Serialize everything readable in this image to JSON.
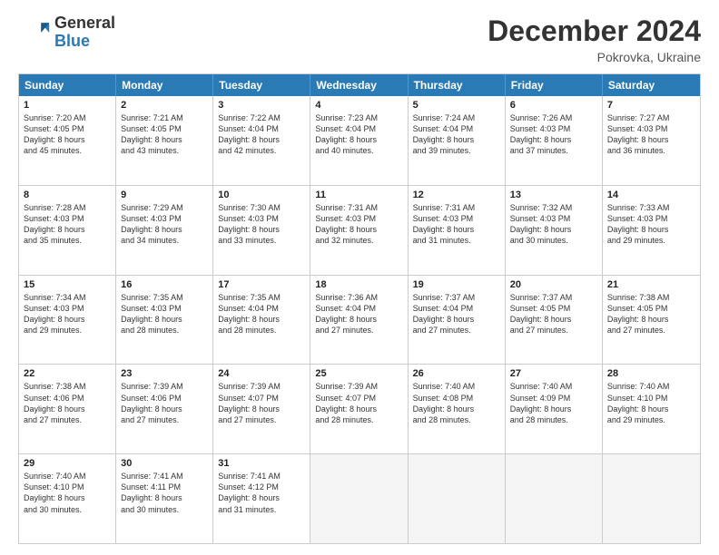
{
  "header": {
    "logo_general": "General",
    "logo_blue": "Blue",
    "month_year": "December 2024",
    "location": "Pokrovka, Ukraine"
  },
  "weekdays": [
    "Sunday",
    "Monday",
    "Tuesday",
    "Wednesday",
    "Thursday",
    "Friday",
    "Saturday"
  ],
  "weeks": [
    [
      {
        "day": "1",
        "lines": [
          "Sunrise: 7:20 AM",
          "Sunset: 4:05 PM",
          "Daylight: 8 hours",
          "and 45 minutes."
        ]
      },
      {
        "day": "2",
        "lines": [
          "Sunrise: 7:21 AM",
          "Sunset: 4:05 PM",
          "Daylight: 8 hours",
          "and 43 minutes."
        ]
      },
      {
        "day": "3",
        "lines": [
          "Sunrise: 7:22 AM",
          "Sunset: 4:04 PM",
          "Daylight: 8 hours",
          "and 42 minutes."
        ]
      },
      {
        "day": "4",
        "lines": [
          "Sunrise: 7:23 AM",
          "Sunset: 4:04 PM",
          "Daylight: 8 hours",
          "and 40 minutes."
        ]
      },
      {
        "day": "5",
        "lines": [
          "Sunrise: 7:24 AM",
          "Sunset: 4:04 PM",
          "Daylight: 8 hours",
          "and 39 minutes."
        ]
      },
      {
        "day": "6",
        "lines": [
          "Sunrise: 7:26 AM",
          "Sunset: 4:03 PM",
          "Daylight: 8 hours",
          "and 37 minutes."
        ]
      },
      {
        "day": "7",
        "lines": [
          "Sunrise: 7:27 AM",
          "Sunset: 4:03 PM",
          "Daylight: 8 hours",
          "and 36 minutes."
        ]
      }
    ],
    [
      {
        "day": "8",
        "lines": [
          "Sunrise: 7:28 AM",
          "Sunset: 4:03 PM",
          "Daylight: 8 hours",
          "and 35 minutes."
        ]
      },
      {
        "day": "9",
        "lines": [
          "Sunrise: 7:29 AM",
          "Sunset: 4:03 PM",
          "Daylight: 8 hours",
          "and 34 minutes."
        ]
      },
      {
        "day": "10",
        "lines": [
          "Sunrise: 7:30 AM",
          "Sunset: 4:03 PM",
          "Daylight: 8 hours",
          "and 33 minutes."
        ]
      },
      {
        "day": "11",
        "lines": [
          "Sunrise: 7:31 AM",
          "Sunset: 4:03 PM",
          "Daylight: 8 hours",
          "and 32 minutes."
        ]
      },
      {
        "day": "12",
        "lines": [
          "Sunrise: 7:31 AM",
          "Sunset: 4:03 PM",
          "Daylight: 8 hours",
          "and 31 minutes."
        ]
      },
      {
        "day": "13",
        "lines": [
          "Sunrise: 7:32 AM",
          "Sunset: 4:03 PM",
          "Daylight: 8 hours",
          "and 30 minutes."
        ]
      },
      {
        "day": "14",
        "lines": [
          "Sunrise: 7:33 AM",
          "Sunset: 4:03 PM",
          "Daylight: 8 hours",
          "and 29 minutes."
        ]
      }
    ],
    [
      {
        "day": "15",
        "lines": [
          "Sunrise: 7:34 AM",
          "Sunset: 4:03 PM",
          "Daylight: 8 hours",
          "and 29 minutes."
        ]
      },
      {
        "day": "16",
        "lines": [
          "Sunrise: 7:35 AM",
          "Sunset: 4:03 PM",
          "Daylight: 8 hours",
          "and 28 minutes."
        ]
      },
      {
        "day": "17",
        "lines": [
          "Sunrise: 7:35 AM",
          "Sunset: 4:04 PM",
          "Daylight: 8 hours",
          "and 28 minutes."
        ]
      },
      {
        "day": "18",
        "lines": [
          "Sunrise: 7:36 AM",
          "Sunset: 4:04 PM",
          "Daylight: 8 hours",
          "and 27 minutes."
        ]
      },
      {
        "day": "19",
        "lines": [
          "Sunrise: 7:37 AM",
          "Sunset: 4:04 PM",
          "Daylight: 8 hours",
          "and 27 minutes."
        ]
      },
      {
        "day": "20",
        "lines": [
          "Sunrise: 7:37 AM",
          "Sunset: 4:05 PM",
          "Daylight: 8 hours",
          "and 27 minutes."
        ]
      },
      {
        "day": "21",
        "lines": [
          "Sunrise: 7:38 AM",
          "Sunset: 4:05 PM",
          "Daylight: 8 hours",
          "and 27 minutes."
        ]
      }
    ],
    [
      {
        "day": "22",
        "lines": [
          "Sunrise: 7:38 AM",
          "Sunset: 4:06 PM",
          "Daylight: 8 hours",
          "and 27 minutes."
        ]
      },
      {
        "day": "23",
        "lines": [
          "Sunrise: 7:39 AM",
          "Sunset: 4:06 PM",
          "Daylight: 8 hours",
          "and 27 minutes."
        ]
      },
      {
        "day": "24",
        "lines": [
          "Sunrise: 7:39 AM",
          "Sunset: 4:07 PM",
          "Daylight: 8 hours",
          "and 27 minutes."
        ]
      },
      {
        "day": "25",
        "lines": [
          "Sunrise: 7:39 AM",
          "Sunset: 4:07 PM",
          "Daylight: 8 hours",
          "and 28 minutes."
        ]
      },
      {
        "day": "26",
        "lines": [
          "Sunrise: 7:40 AM",
          "Sunset: 4:08 PM",
          "Daylight: 8 hours",
          "and 28 minutes."
        ]
      },
      {
        "day": "27",
        "lines": [
          "Sunrise: 7:40 AM",
          "Sunset: 4:09 PM",
          "Daylight: 8 hours",
          "and 28 minutes."
        ]
      },
      {
        "day": "28",
        "lines": [
          "Sunrise: 7:40 AM",
          "Sunset: 4:10 PM",
          "Daylight: 8 hours",
          "and 29 minutes."
        ]
      }
    ],
    [
      {
        "day": "29",
        "lines": [
          "Sunrise: 7:40 AM",
          "Sunset: 4:10 PM",
          "Daylight: 8 hours",
          "and 30 minutes."
        ]
      },
      {
        "day": "30",
        "lines": [
          "Sunrise: 7:41 AM",
          "Sunset: 4:11 PM",
          "Daylight: 8 hours",
          "and 30 minutes."
        ]
      },
      {
        "day": "31",
        "lines": [
          "Sunrise: 7:41 AM",
          "Sunset: 4:12 PM",
          "Daylight: 8 hours",
          "and 31 minutes."
        ]
      },
      null,
      null,
      null,
      null
    ]
  ]
}
